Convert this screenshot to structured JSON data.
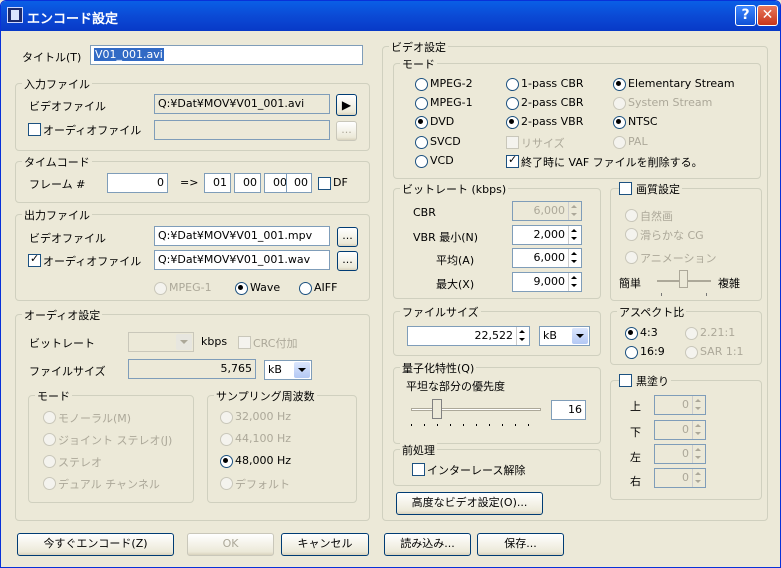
{
  "window": {
    "title": "エンコード設定",
    "help_label": "?",
    "close_label": "✕",
    "colors": {
      "titlebar": "#0b4ad5",
      "face": "#ece9d8",
      "selection": "#316ac5"
    }
  },
  "title_field": {
    "label": "タイトル(T)",
    "value": "V01_001.avi"
  },
  "input_files": {
    "legend": "入力ファイル",
    "video_label": "ビデオファイル",
    "video_path": "Q:¥Dat¥MOV¥V01_001.avi",
    "play_label": "▶",
    "audio_label": "オーディオファイル",
    "audio_path": "",
    "browse": "..."
  },
  "timecode": {
    "legend": "タイムコード",
    "frame_label": "フレーム #",
    "frame_value": "0",
    "arrow": "=>",
    "hh": "01",
    "mm": "00",
    "ss": "00",
    "ff": "00",
    "df_label": "DF"
  },
  "output_files": {
    "legend": "出力ファイル",
    "video_label": "ビデオファイル",
    "video_path": "Q:¥Dat¥MOV¥V01_001.mpv",
    "audio_label": "オーディオファイル",
    "audio_path": "Q:¥Dat¥MOV¥V01_001.wav",
    "browse": "...",
    "formats": [
      "MPEG-1",
      "Wave",
      "AIFF"
    ],
    "selected_format": "Wave"
  },
  "audio": {
    "legend": "オーディオ設定",
    "bitrate_label": "ビットレート",
    "bitrate_value": "",
    "kbps": "kbps",
    "crc_label": "CRC付加",
    "filesize_label": "ファイルサイズ",
    "filesize_value": "5,765",
    "filesize_unit": "kB",
    "mode": {
      "legend": "モード",
      "options": [
        "モノーラル(M)",
        "ジョイント ステレオ(J)",
        "ステレオ",
        "デュアル チャンネル"
      ]
    },
    "sampling": {
      "legend": "サンプリング周波数",
      "options": [
        "32,000 Hz",
        "44,100 Hz",
        "48,000 Hz",
        "デフォルト"
      ],
      "selected": "48,000 Hz"
    }
  },
  "video": {
    "legend": "ビデオ設定",
    "mode": {
      "legend": "モード",
      "col1": [
        "MPEG-2",
        "MPEG-1",
        "DVD",
        "SVCD",
        "VCD"
      ],
      "col2": [
        "1-pass CBR",
        "2-pass CBR",
        "2-pass VBR",
        "リサイズ"
      ],
      "col3": [
        "Elementary Stream",
        "System Stream",
        "NTSC",
        "PAL"
      ],
      "delete_vaf": "終了時に VAF ファイルを削除する。",
      "selected_format": "DVD",
      "selected_pass": "2-pass VBR",
      "selected_stream": "Elementary Stream",
      "selected_tv": "NTSC"
    },
    "bitrate": {
      "legend": "ビットレート (kbps)",
      "cbr_label": "CBR",
      "cbr_value": "6,000",
      "vbr_min_label": "VBR 最小(N)",
      "vbr_min_value": "2,000",
      "avg_label": "平均(A)",
      "avg_value": "6,000",
      "max_label": "最大(X)",
      "max_value": "9,000"
    },
    "quality": {
      "legend": "画質設定",
      "options": [
        "自然画",
        "滑らかな CG",
        "アニメーション"
      ],
      "simple": "簡単",
      "complex": "複雑",
      "level": 0.5
    },
    "filesize": {
      "legend": "ファイルサイズ",
      "value": "22,522",
      "unit": "kB"
    },
    "aspect": {
      "legend": "アスペクト比",
      "options": [
        "4:3",
        "2.21:1",
        "16:9",
        "SAR 1:1"
      ],
      "selected": "4:3"
    },
    "quant": {
      "legend": "量子化特性(Q)",
      "label": "平坦な部分の優先度",
      "value": "16",
      "level": 0.2
    },
    "blackout": {
      "legend": "黒塗り",
      "top": "上",
      "bottom": "下",
      "left": "左",
      "right": "右",
      "values": [
        "0",
        "0",
        "0",
        "0"
      ]
    },
    "preprocess": {
      "legend": "前処理",
      "deinterlace": "インターレース解除"
    },
    "advanced_button": "高度なビデオ設定(O)..."
  },
  "buttons": {
    "encode": "今すぐエンコード(Z)",
    "ok": "OK",
    "cancel": "キャンセル",
    "load": "読み込み...",
    "save": "保存..."
  }
}
